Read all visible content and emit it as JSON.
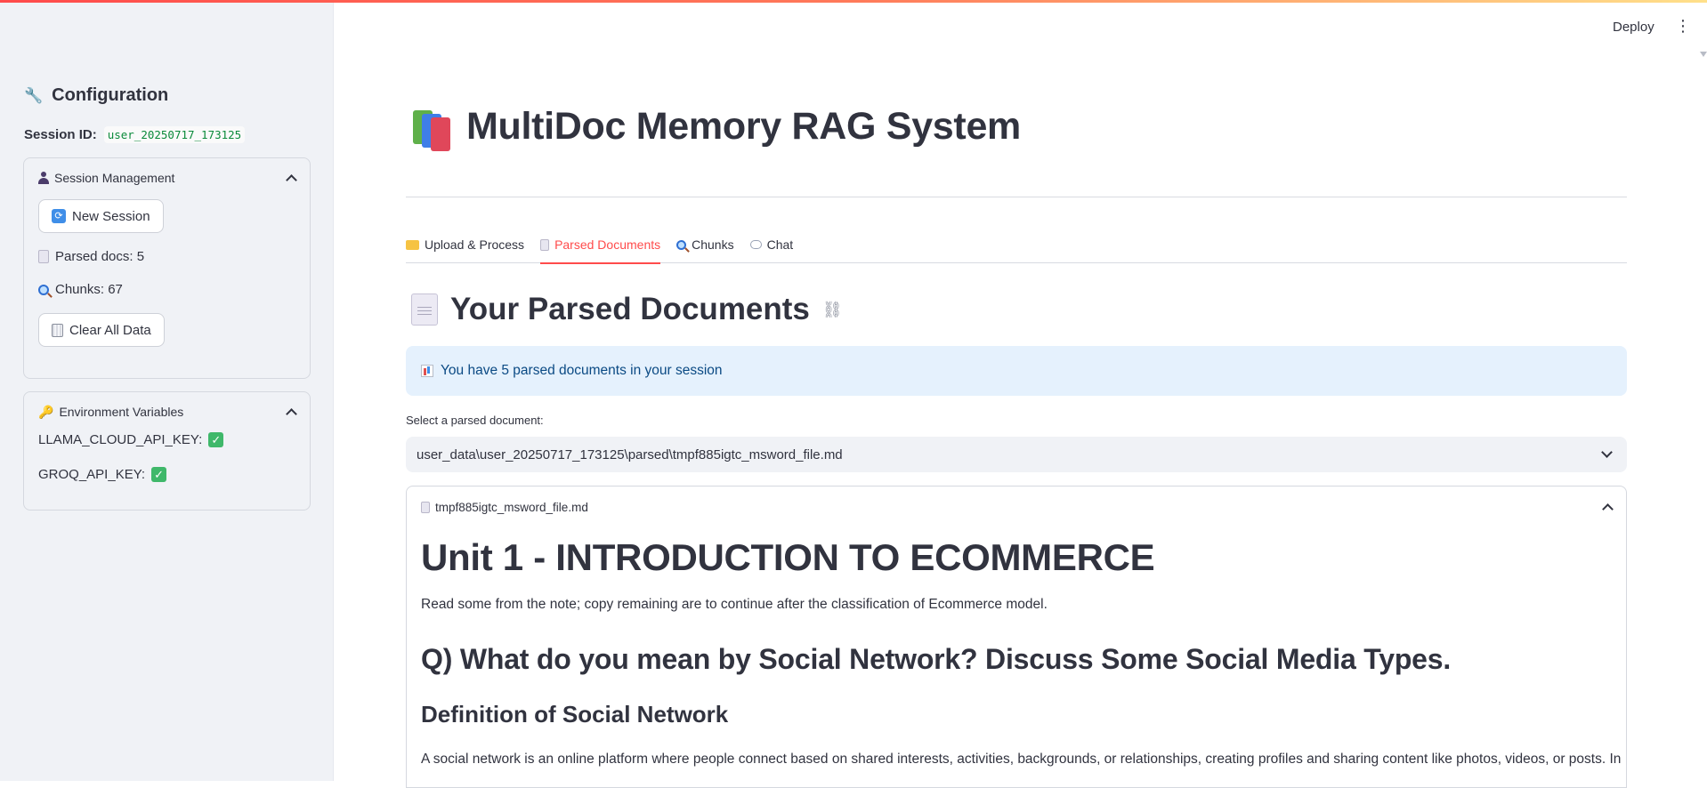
{
  "header": {
    "deploy_label": "Deploy",
    "menu_glyph": "⋮"
  },
  "sidebar": {
    "title": "Configuration",
    "session_id_label": "Session ID:",
    "session_id_value": "user_20250717_173125",
    "session_management": {
      "title": "Session Management",
      "new_session_label": "New Session",
      "parsed_docs": "Parsed docs: 5",
      "chunks": "Chunks: 67",
      "clear_label": "Clear All Data"
    },
    "env_vars": {
      "title": "Environment Variables",
      "items": [
        {
          "label": "LLAMA_CLOUD_API_KEY:",
          "status": "✓"
        },
        {
          "label": "GROQ_API_KEY:",
          "status": "✓"
        }
      ]
    }
  },
  "main": {
    "title": "MultiDoc Memory RAG System",
    "tabs": [
      {
        "label": "Upload & Process",
        "icon": "folder-icon"
      },
      {
        "label": "Parsed Documents",
        "icon": "document-icon"
      },
      {
        "label": "Chunks",
        "icon": "magnifier-icon"
      },
      {
        "label": "Chat",
        "icon": "speech-bubble-icon"
      }
    ],
    "active_tab": "Parsed Documents",
    "section_title": "Your Parsed Documents",
    "info_text": "You have 5 parsed documents in your session",
    "select_label": "Select a parsed document:",
    "select_value": "user_data\\user_20250717_173125\\parsed\\tmpf885igtc_msword_file.md",
    "doc_expander_title": "tmpf885igtc_msword_file.md",
    "doc": {
      "h1": "Unit 1 - INTRODUCTION TO ECOMMERCE",
      "p1": "Read some from the note; copy remaining are to continue after the classification of Ecommerce model.",
      "h2": "Q) What do you mean by Social Network? Discuss Some Social Media Types.",
      "h3": "Definition of Social Network",
      "p2": "A social network is an online platform where people connect based on shared interests, activities, backgrounds, or relationships, creating profiles and sharing content like photos, videos, or posts. In"
    }
  },
  "colors": {
    "accent": "#ff4b4b",
    "info_bg": "#e5f1fd",
    "info_text": "#0b4a84",
    "sidebar_bg": "#f0f2f6"
  }
}
